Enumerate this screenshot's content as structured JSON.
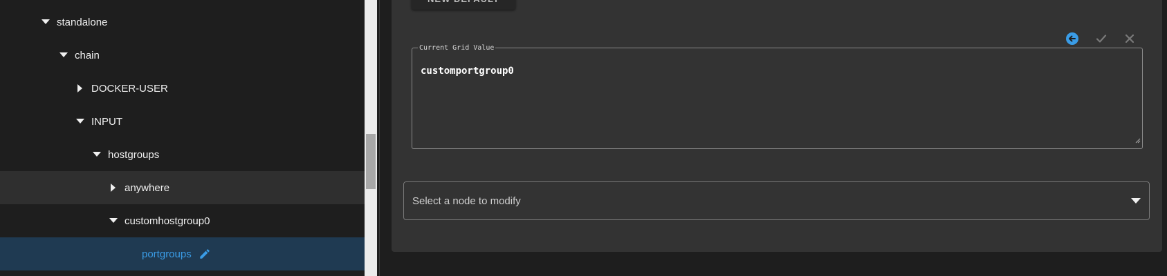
{
  "tree": {
    "items": [
      {
        "label": "standalone",
        "expanded": true
      },
      {
        "label": "chain",
        "expanded": true
      },
      {
        "label": "DOCKER-USER",
        "expanded": false
      },
      {
        "label": "INPUT",
        "expanded": true
      },
      {
        "label": "hostgroups",
        "expanded": true
      },
      {
        "label": "anywhere",
        "expanded": false
      },
      {
        "label": "customhostgroup0",
        "expanded": true
      },
      {
        "label": "portgroups",
        "selected": true
      }
    ]
  },
  "toolbar": {
    "top_button_label": "NEW DEFAULT"
  },
  "editor": {
    "legend": "Current Grid Value",
    "value": "customportgroup0"
  },
  "node_select": {
    "placeholder": "Select a node to modify"
  },
  "colors": {
    "accent": "#3a9ce6",
    "selected_row": "#1f3a52",
    "panel": "#333333",
    "background": "#1e1e1e"
  },
  "icons": {
    "back": "arrow-left-circle-icon",
    "confirm": "check-icon",
    "cancel": "close-icon",
    "edit": "pencil-icon",
    "dropdown": "caret-down-icon"
  }
}
